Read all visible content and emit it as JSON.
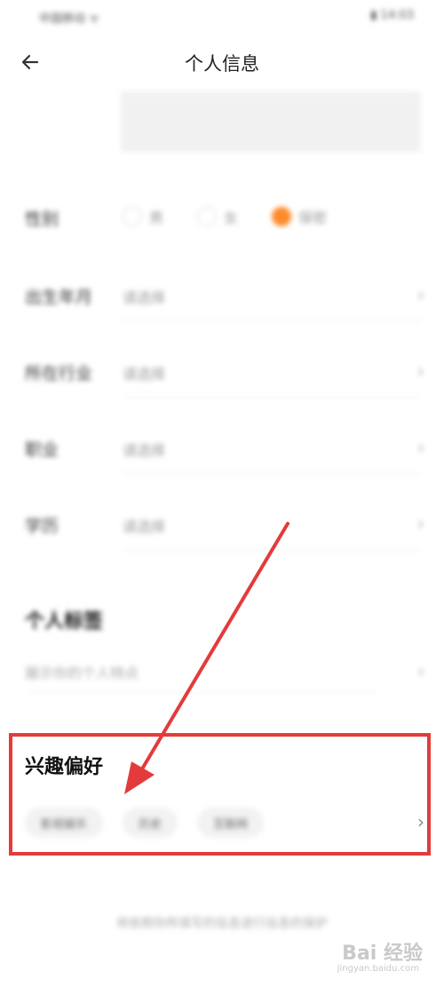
{
  "status_bar": {
    "left": "中国移动 ᯤ",
    "right": "▮ 14:03"
  },
  "header": {
    "title": "个人信息"
  },
  "form": {
    "gender": {
      "label": "性别",
      "options": [
        "男",
        "女",
        "保密"
      ],
      "selected": "保密"
    },
    "rows": [
      {
        "label": "出生年月",
        "value": "请选择"
      },
      {
        "label": "所在行业",
        "value": "请选择"
      },
      {
        "label": "职业",
        "value": "请选择"
      },
      {
        "label": "学历",
        "value": "请选择"
      }
    ]
  },
  "personal_tags": {
    "title": "个人标签",
    "hint": "展示你的个人特点"
  },
  "interests": {
    "title": "兴趣偏好",
    "chips": [
      "影视娱乐",
      "历史",
      "互联网"
    ]
  },
  "footer": {
    "note": "将依照你所填写的信息进行信息的保护"
  },
  "watermark": {
    "text": "Bai 经验",
    "sub": "jingyan.baidu.com"
  },
  "colors": {
    "accent": "#ff8a2b",
    "annotation": "#e33b3b"
  }
}
